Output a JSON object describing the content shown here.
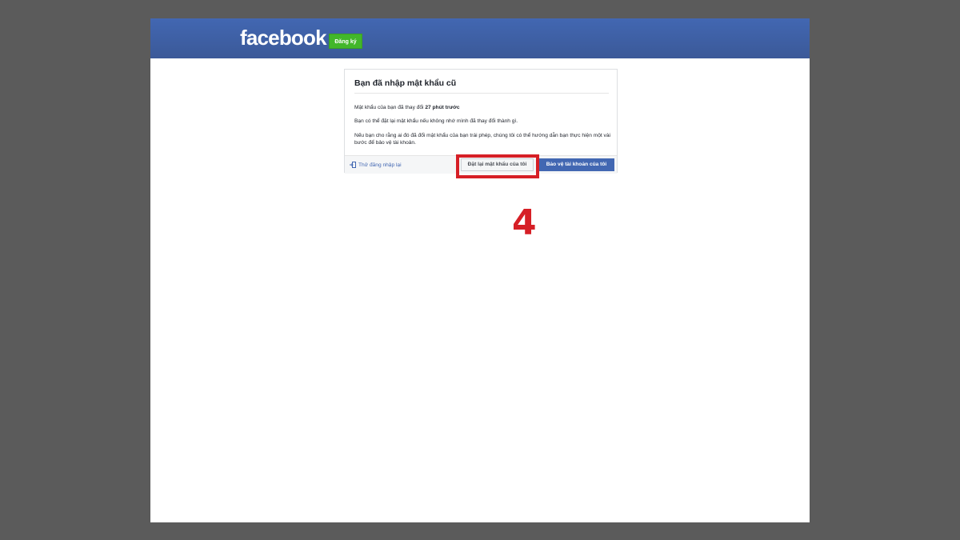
{
  "header": {
    "logo_text": "facebook",
    "signup_label": "Đăng ký"
  },
  "card": {
    "title": "Bạn đã nhập mật khẩu cũ",
    "line1_prefix": "Mật khẩu của bạn đã thay đổi ",
    "line1_bold": "27 phút trước",
    "line2": "Bạn có thể đặt lại mật khẩu nếu không nhớ mình đã thay đổi thành gì.",
    "line3": "Nếu bạn cho rằng ai đó đã đổi mật khẩu của bạn trái phép, chúng tôi có thể hướng dẫn bạn thực hiện một vài bước để bảo vệ tài khoản.",
    "back_link_label": "Thử đăng nhập lại",
    "reset_button_label": "Đặt lại mật khẩu của tôi",
    "protect_button_label": "Bảo vệ tài khoản của tôi"
  },
  "annotation": {
    "step_number": "4",
    "highlight_color": "#d61f26"
  },
  "colors": {
    "facebook_blue": "#3b5998",
    "signup_green": "#42b72a",
    "button_blue": "#4267b2"
  },
  "icons": {
    "back": "login-arrow-icon"
  }
}
